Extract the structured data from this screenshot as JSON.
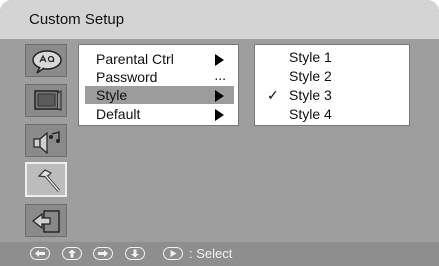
{
  "window": {
    "title": "Custom Setup"
  },
  "sidebar": {
    "icons": [
      {
        "name": "language-icon",
        "active": false
      },
      {
        "name": "display-icon",
        "active": false
      },
      {
        "name": "audio-icon",
        "active": false
      },
      {
        "name": "custom-setup-icon",
        "active": true
      },
      {
        "name": "exit-icon",
        "active": false
      }
    ]
  },
  "menu": {
    "items": [
      {
        "label": "Parental Ctrl",
        "indicator": "arrow"
      },
      {
        "label": "Password",
        "indicator": "..."
      },
      {
        "label": "Style",
        "indicator": "arrow",
        "selected": true
      },
      {
        "label": "Default",
        "indicator": "arrow"
      }
    ]
  },
  "submenu": {
    "items": [
      {
        "label": "Style 1",
        "checked": false
      },
      {
        "label": "Style 2",
        "checked": false
      },
      {
        "label": "Style 3",
        "checked": true,
        "check_mark": "✓"
      },
      {
        "label": "Style 4",
        "checked": false
      }
    ]
  },
  "footer": {
    "controls": [
      "left-arrow-icon",
      "up-arrow-icon",
      "right-arrow-icon",
      "down-arrow-icon",
      "play-icon"
    ],
    "hint": ": Select"
  }
}
